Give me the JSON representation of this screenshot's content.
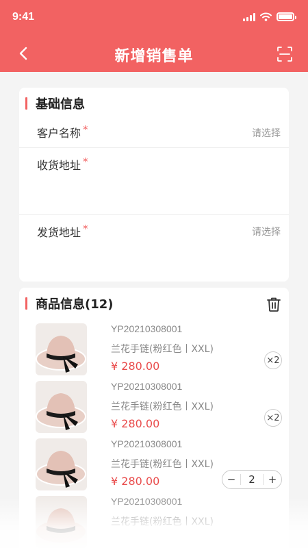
{
  "status_bar": {
    "time": "9:41"
  },
  "nav": {
    "title": "新增销售单"
  },
  "basic_info": {
    "title": "基础信息",
    "fields": [
      {
        "label": "客户名称",
        "required": "*",
        "value": "请选择"
      },
      {
        "label": "收货地址",
        "required": "*",
        "value": ""
      },
      {
        "label": "发货地址",
        "required": "*",
        "value": "请选择"
      }
    ]
  },
  "product_info": {
    "title": "商品信息(12)",
    "items": [
      {
        "code": "YP20210308001",
        "name": "兰花手链(粉红色丨XXL)",
        "price": "¥ 280.00",
        "qty_badge": "×2"
      },
      {
        "code": "YP20210308001",
        "name": "兰花手链(粉红色丨XXL)",
        "price": "¥ 280.00",
        "qty_badge": "×2"
      },
      {
        "code": "YP20210308001",
        "name": "兰花手链(粉红色丨XXL)",
        "price": "¥ 280.00",
        "stepper": {
          "minus": "−",
          "value": "2",
          "plus": "+"
        }
      },
      {
        "code": "YP20210308001",
        "name": "兰花手链(粉红色丨XXL)",
        "price": ""
      }
    ]
  },
  "colors": {
    "accent": "#f26262",
    "price": "#e94b4b"
  },
  "icons": {
    "back": "chevron-left-icon",
    "scan": "scan-icon",
    "trash": "trash-icon"
  }
}
